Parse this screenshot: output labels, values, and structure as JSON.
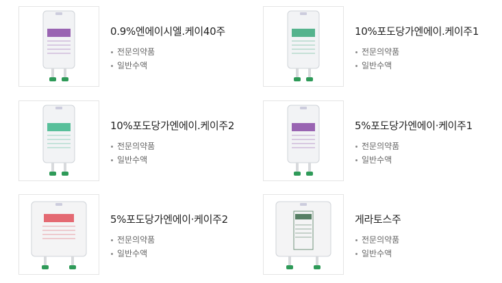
{
  "products": [
    {
      "name": "0.9%엔에이시엘.케이40주",
      "category": "전문의약품",
      "type": "일반수액",
      "label_color": "#8a4aa6"
    },
    {
      "name": "10%포도당가엔에이.케이주1",
      "category": "전문의약품",
      "type": "일반수액",
      "label_color": "#3aa77a"
    },
    {
      "name": "10%포도당가엔에이.케이주2",
      "category": "전문의약품",
      "type": "일반수액",
      "label_color": "#3db58a"
    },
    {
      "name": "5%포도당가엔에이·케이주1",
      "category": "전문의약품",
      "type": "일반수액",
      "label_color": "#8a4aa6"
    },
    {
      "name": "5%포도당가엔에이·케이주2",
      "category": "전문의약품",
      "type": "일반수액",
      "label_color": "#e0505a"
    },
    {
      "name": "게라토스주",
      "category": "전문의약품",
      "type": "일반수액",
      "label_color": "#3a6a4a"
    }
  ],
  "icons": {
    "bag": "iv-bag-icon",
    "cap": "port-cap-icon"
  },
  "colors": {
    "cap": "#2e9a58",
    "border": "#e4e4e4"
  }
}
